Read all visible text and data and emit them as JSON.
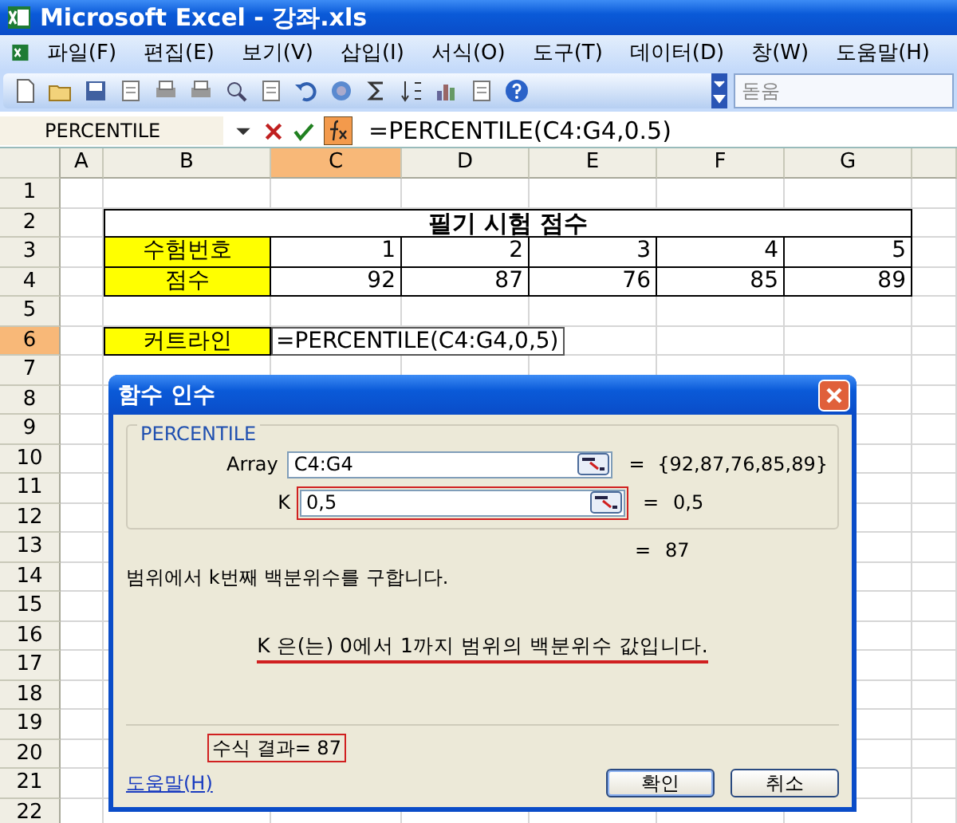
{
  "window": {
    "title": "Microsoft Excel - 강좌.xls"
  },
  "menu": {
    "items": [
      "파일(F)",
      "편집(E)",
      "보기(V)",
      "삽입(I)",
      "서식(O)",
      "도구(T)",
      "데이터(D)",
      "창(W)",
      "도움말(H)"
    ]
  },
  "toolbar": {
    "font_box": "돋움"
  },
  "formula_bar": {
    "name_box": "PERCENTILE",
    "formula": "=PERCENTILE(C4:G4,0.5)"
  },
  "sheet": {
    "columns": [
      {
        "label": "A",
        "selected": false
      },
      {
        "label": "B",
        "selected": false
      },
      {
        "label": "C",
        "selected": true
      },
      {
        "label": "D",
        "selected": false
      },
      {
        "label": "E",
        "selected": false
      },
      {
        "label": "F",
        "selected": false
      },
      {
        "label": "G",
        "selected": false
      }
    ],
    "rows": [
      {
        "label": "1",
        "selected": false
      },
      {
        "label": "2",
        "selected": false
      },
      {
        "label": "3",
        "selected": false
      },
      {
        "label": "4",
        "selected": false
      },
      {
        "label": "5",
        "selected": false
      },
      {
        "label": "6",
        "selected": true
      },
      {
        "label": "7",
        "selected": false
      },
      {
        "label": "8",
        "selected": false
      },
      {
        "label": "9",
        "selected": false
      },
      {
        "label": "10",
        "selected": false
      },
      {
        "label": "11",
        "selected": false
      },
      {
        "label": "12",
        "selected": false
      },
      {
        "label": "13",
        "selected": false
      },
      {
        "label": "14",
        "selected": false
      },
      {
        "label": "15",
        "selected": false
      },
      {
        "label": "16",
        "selected": false
      },
      {
        "label": "17",
        "selected": false
      },
      {
        "label": "18",
        "selected": false
      },
      {
        "label": "19",
        "selected": false
      },
      {
        "label": "20",
        "selected": false
      },
      {
        "label": "21",
        "selected": false
      },
      {
        "label": "22",
        "selected": false
      }
    ],
    "score_table": {
      "title": "필기 시험 점수",
      "rows": [
        {
          "label": "수험번호",
          "values": [
            "1",
            "2",
            "3",
            "4",
            "5"
          ]
        },
        {
          "label": "점수",
          "values": [
            "92",
            "87",
            "76",
            "85",
            "89"
          ]
        }
      ]
    },
    "cutoff": {
      "label": "커트라인",
      "formula": "=PERCENTILE(C4:G4,0,5)"
    }
  },
  "dialog": {
    "title": "함수 인수",
    "function_name": "PERCENTILE",
    "arguments": [
      {
        "label": "Array",
        "value": "C4:G4",
        "equals": "=",
        "result": "{92,87,76,85,89}",
        "highlighted": false
      },
      {
        "label": "K",
        "value": "0,5",
        "equals": "=",
        "result": "0,5",
        "highlighted": true
      }
    ],
    "total": {
      "equals": "=",
      "value": "87"
    },
    "description": "범위에서 k번째 백분위수를 구합니다.",
    "argument_help": {
      "text": "K 은(는) 0에서 1까지 범위의 백분위수 값입니다.",
      "highlighted": true
    },
    "formula_result": {
      "text": "수식 결과= 87",
      "highlighted": true
    },
    "help_link": "도움말(H)",
    "buttons": [
      "확인",
      "취소"
    ]
  }
}
